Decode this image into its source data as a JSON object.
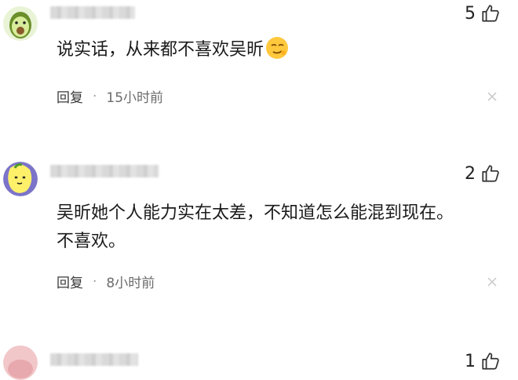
{
  "comments": [
    {
      "avatar_icon": "avocado-avatar-icon",
      "likes": "5",
      "text_lines": [
        "说实话，从来都不喜欢吴昕"
      ],
      "reply_label": "回复",
      "separator": "·",
      "time": "15小时前"
    },
    {
      "avatar_icon": "lemon-avatar-icon",
      "likes": "2",
      "text_lines": [
        "吴昕她个人能力实在太差，不知道怎么能混到现在。",
        "不喜欢。"
      ],
      "reply_label": "回复",
      "separator": "·",
      "time": "8小时前"
    },
    {
      "avatar_icon": "pink-avatar-icon",
      "likes": "1"
    }
  ],
  "colors": {
    "text": "#1b1b1b",
    "meta": "#6b6b6b",
    "background": "#ffffff"
  },
  "icons": {
    "like": "thumb-up-icon",
    "close": "close-icon",
    "emoji": "smirk-emoji-icon"
  }
}
